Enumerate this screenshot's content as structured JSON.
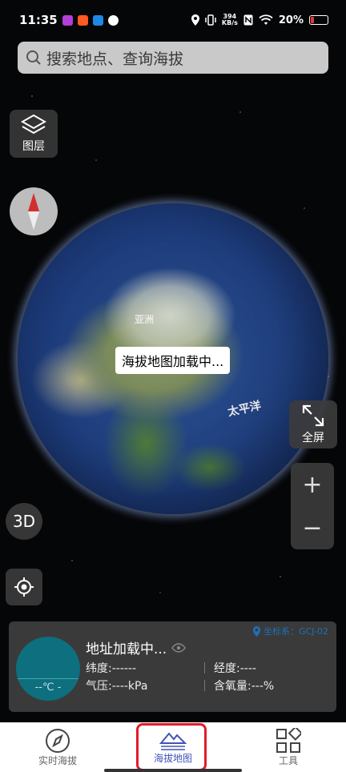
{
  "status_bar": {
    "time": "11:35",
    "net_speed_value": "394",
    "net_speed_unit": "KB/s",
    "battery": "20%",
    "battery_level": 0.2
  },
  "search": {
    "placeholder": "搜索地点、查询海拔"
  },
  "map_controls": {
    "layers_label": "图层",
    "three_d_label": "3D",
    "fullscreen_label": "全屏",
    "zoom_in": "+",
    "zoom_out": "−"
  },
  "globe": {
    "label_asia": "亚洲",
    "label_pacific": "太平洋",
    "loading_toast": "海拔地图加载中..."
  },
  "info_card": {
    "coord_system": "坐标系：GCJ-02",
    "address": "地址加载中...",
    "temperature": "--℃ -",
    "latitude": "纬度:------",
    "longitude": "经度:----",
    "pressure": "气压:----kPa",
    "oxygen": "含氧量:---%"
  },
  "bottom_nav": {
    "items": [
      {
        "label": "实时海拔"
      },
      {
        "label": "海拔地图"
      },
      {
        "label": "工具"
      }
    ],
    "active_index": 1
  },
  "colors": {
    "accent": "#4354b8",
    "highlight_outline": "#e21b2b",
    "temp_circle": "#0e6f7f",
    "coord_text": "#1f6fb8"
  }
}
